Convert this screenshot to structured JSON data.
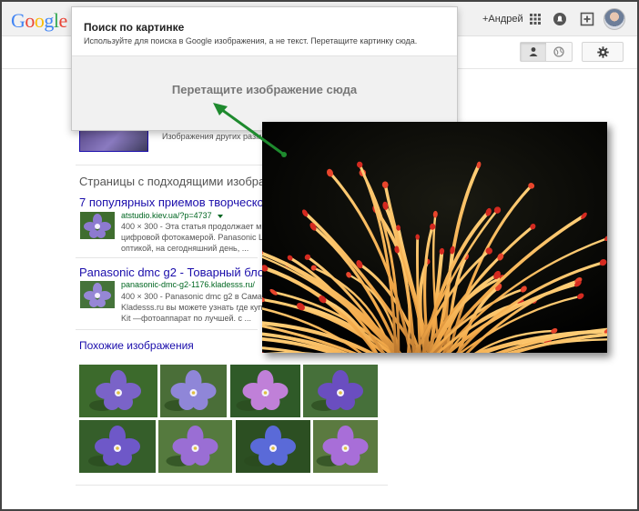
{
  "header": {
    "logo": "Google",
    "logo_colors": [
      "#4285f4",
      "#ea4335",
      "#fbbc05",
      "#4285f4",
      "#34a853",
      "#ea4335"
    ],
    "user_link": "+Андрей",
    "icons": [
      "apps-icon",
      "notifications-icon",
      "share-icon",
      "avatar"
    ]
  },
  "dialog": {
    "title": "Поиск по картинке",
    "description": "Используйте для поиска в Google изображения, а не текст. Перетащите картинку сюда.",
    "drop_text": "Перетащите изображение сюда"
  },
  "main": {
    "other_sizes": "Изображения других разм",
    "pages_heading": "Страницы с подходящими изобраз",
    "results": [
      {
        "title": "7 популярных приемов творческой",
        "url": "atstudio.kiev.ua/?p=4737",
        "snippet": [
          "400 × 300 - Эта статья продолжает м",
          "цифровой фотокамерой. Panasonic L",
          "оптикой, на сегодняшний день, ..."
        ]
      },
      {
        "title": "Panasonic dmc g2 - Товарный блог",
        "url": "panasonic-dmc-g2-1176.kladesss.ru/",
        "snippet": [
          "400 × 300 - Panasonic dmc g2 в Сама",
          "Kladesss.ru вы можете узнать где купи",
          "Kit —фотоаппарат по лучшей. с ..."
        ]
      }
    ],
    "similar_heading": "Похожие изображения"
  },
  "colors": {
    "link": "#1a0dab",
    "url": "#006621",
    "arrow": "#1e8a2e",
    "flower_orange": "#f0a040",
    "flower_red": "#d42a20"
  }
}
